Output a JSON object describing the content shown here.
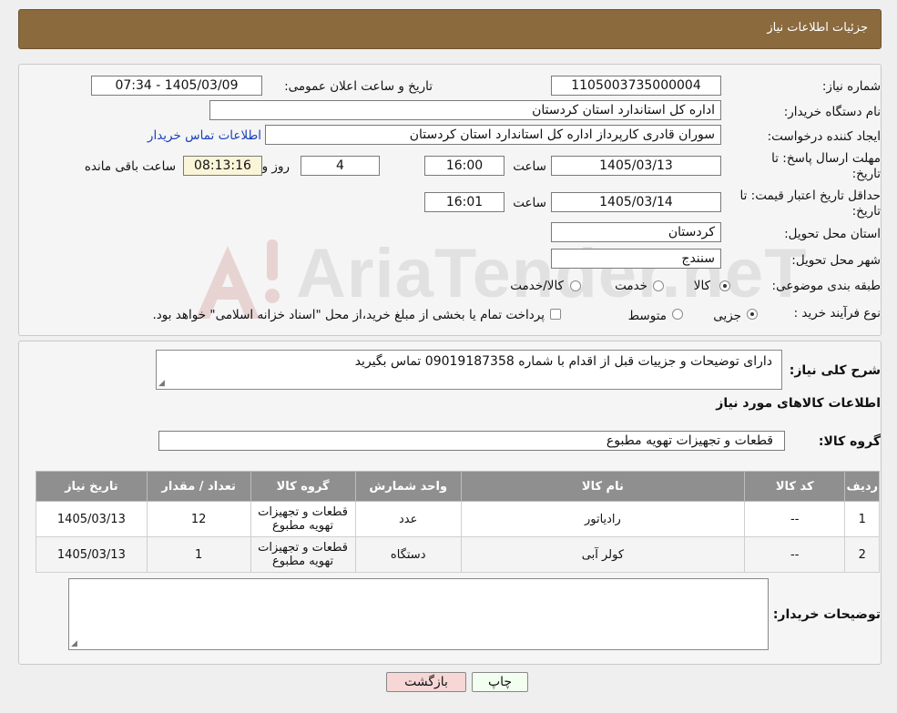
{
  "page_title": "جزئیات اطلاعات نیاز",
  "watermark": "AriaTender.neT",
  "form": {
    "need_number_label": "شماره نیاز:",
    "need_number": "1105003735000004",
    "announce_label": "تاریخ و ساعت اعلان عمومی:",
    "announce_value": "1405/03/09 - 07:34",
    "buyer_org_label": "نام دستگاه خریدار:",
    "buyer_org": "اداره کل استاندارد استان کردستان",
    "requester_label": "ایجاد کننده درخواست:",
    "requester": "سوران قادری کارپرداز اداره کل استاندارد استان کردستان",
    "contact_link": "اطلاعات تماس خریدار",
    "send_deadline_label_1": "مهلت ارسال پاسخ: تا",
    "send_deadline_label_2": "تاریخ:",
    "send_date": "1405/03/13",
    "time_label": "ساعت",
    "send_time": "16:00",
    "days": "4",
    "days_label": "روز و",
    "remaining_time": "08:13:16",
    "remaining_label": "ساعت باقی مانده",
    "price_validity_label_1": "حداقل تاریخ اعتبار قیمت: تا",
    "price_validity_label_2": "تاریخ:",
    "price_date": "1405/03/14",
    "price_time": "16:01",
    "province_label": "استان محل تحویل:",
    "province": "کردستان",
    "city_label": "شهر محل تحویل:",
    "city": "سنندج",
    "category_label": "طبقه بندی موضوعی:",
    "category_options": [
      "کالا",
      "خدمت",
      "کالا/خدمت"
    ],
    "process_label": "نوع فرآیند خرید :",
    "process_options": [
      "جزیی",
      "متوسط"
    ],
    "process_note": "پرداخت تمام یا بخشی از مبلغ خرید،از محل \"اسناد خزانه اسلامی\" خواهد بود."
  },
  "details": {
    "summary_label": "شرح کلی نیاز:",
    "summary": "دارای توضیحات و جزییات قبل از اقدام با شماره  09019187358  تماس بگیرید",
    "goods_info_title": "اطلاعات کالاهای مورد نیاز",
    "goods_group_label": "گروه کالا:",
    "goods_group": "قطعات و تجهیزات تهویه مطبوع",
    "table_headers": [
      "ردیف",
      "کد کالا",
      "نام کالا",
      "واحد شمارش",
      "گروه کالا",
      "تعداد / مقدار",
      "تاریخ نیاز"
    ],
    "rows": [
      {
        "row": "1",
        "code": "--",
        "name": "رادیاتور",
        "unit": "عدد",
        "group_1": "قطعات و تجهیزات",
        "group_2": "تهویه مطبوع",
        "qty": "12",
        "date": "1405/03/13"
      },
      {
        "row": "2",
        "code": "--",
        "name": "کولر آبی",
        "unit": "دستگاه",
        "group_1": "قطعات و تجهیزات",
        "group_2": "تهویه مطبوع",
        "qty": "1",
        "date": "1405/03/13"
      }
    ],
    "buyer_notes_label": "توضیحات خریدار:",
    "buyer_notes": ""
  },
  "buttons": {
    "print": "چاپ",
    "back": "بازگشت"
  },
  "colors": {
    "header": "#8b6a3e",
    "table_header": "#8f8f8f",
    "back_button": "#f7d6d6",
    "highlight": "#fbf5d8"
  }
}
